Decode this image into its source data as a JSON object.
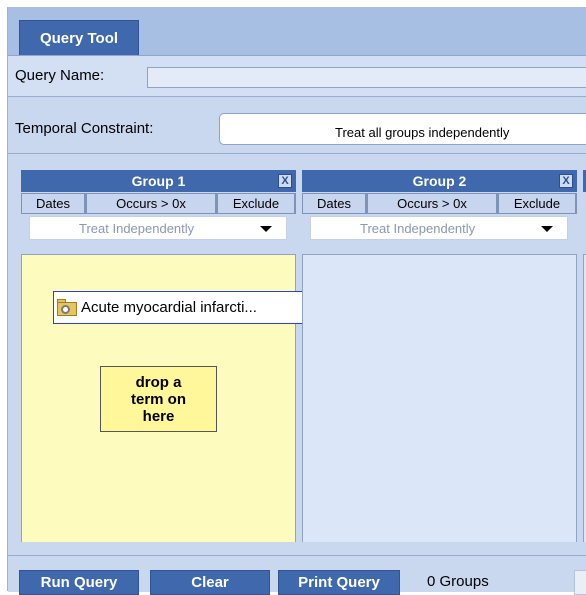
{
  "tab": {
    "label": "Query Tool"
  },
  "query_name": {
    "label": "Query Name:",
    "value": ""
  },
  "temporal": {
    "label": "Temporal Constraint:",
    "value": "Treat all groups independently"
  },
  "groups": [
    {
      "title": "Group 1",
      "close_label": "X",
      "options": {
        "dates": "Dates",
        "occurs": "Occurs > 0x",
        "exclude": "Exclude"
      },
      "treat": "Treat Independently",
      "concept": "Acute myocardial infarcti...",
      "drop_hint": "drop a term on here"
    },
    {
      "title": "Group 2",
      "close_label": "X",
      "options": {
        "dates": "Dates",
        "occurs": "Occurs > 0x",
        "exclude": "Exclude"
      },
      "treat": "Treat Independently"
    }
  ],
  "footer": {
    "run": "Run Query",
    "clear": "Clear",
    "print": "Print Query",
    "groups_count": "0 Groups"
  },
  "colors": {
    "header_blue": "#3f68ad",
    "group1_panel": "#fefbbf",
    "group2_panel": "#dbe6f8",
    "drop_target": "#fff799"
  },
  "icons": {
    "concept_icon": "folder-search-icon",
    "close": "close-icon",
    "dropdown": "dropdown-arrow-icon"
  }
}
